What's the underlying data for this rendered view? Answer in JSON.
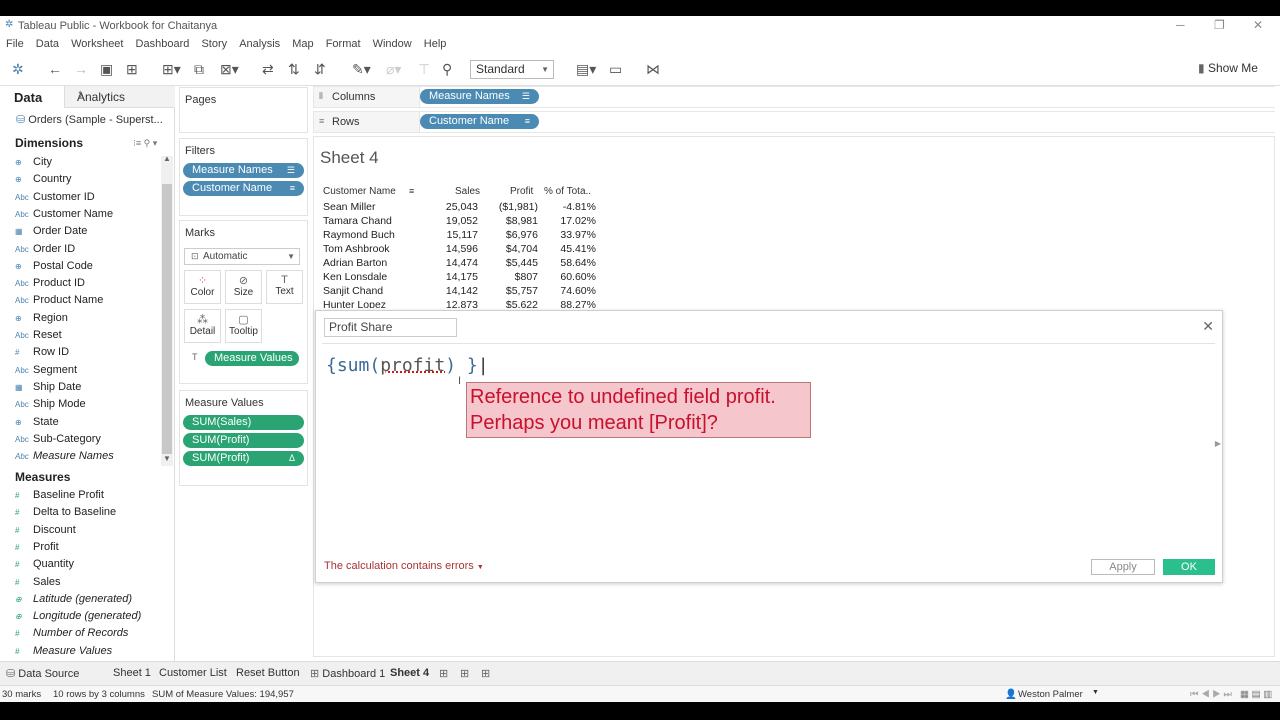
{
  "window": {
    "title": "Tableau Public - Workbook for Chaitanya",
    "controls": [
      "─",
      "❐",
      "✕"
    ]
  },
  "menu": [
    "File",
    "Data",
    "Worksheet",
    "Dashboard",
    "Story",
    "Analysis",
    "Map",
    "Format",
    "Window",
    "Help"
  ],
  "toolbar": {
    "fit": "Standard",
    "show_me": "Show Me"
  },
  "left_pane": {
    "tab_data": "Data",
    "tab_analytics": "Analytics",
    "datasource": "Orders (Sample - Superst...",
    "dimensions_label": "Dimensions",
    "dimensions": [
      {
        "icon": "⊕",
        "label": "City"
      },
      {
        "icon": "⊕",
        "label": "Country"
      },
      {
        "icon": "Abc",
        "label": "Customer ID"
      },
      {
        "icon": "Abc",
        "label": "Customer Name"
      },
      {
        "icon": "▦",
        "label": "Order Date"
      },
      {
        "icon": "Abc",
        "label": "Order ID"
      },
      {
        "icon": "⊕",
        "label": "Postal Code"
      },
      {
        "icon": "Abc",
        "label": "Product ID"
      },
      {
        "icon": "Abc",
        "label": "Product Name"
      },
      {
        "icon": "⊕",
        "label": "Region"
      },
      {
        "icon": "Abc",
        "label": "Reset"
      },
      {
        "icon": "#",
        "label": "Row ID"
      },
      {
        "icon": "Abc",
        "label": "Segment"
      },
      {
        "icon": "▦",
        "label": "Ship Date"
      },
      {
        "icon": "Abc",
        "label": "Ship Mode"
      },
      {
        "icon": "⊕",
        "label": "State"
      },
      {
        "icon": "Abc",
        "label": "Sub-Category"
      },
      {
        "icon": "Abc",
        "label": "Measure Names"
      }
    ],
    "measures_label": "Measures",
    "measures": [
      {
        "icon": "#",
        "label": "Baseline Profit"
      },
      {
        "icon": "#",
        "label": "Delta to Baseline"
      },
      {
        "icon": "#",
        "label": "Discount"
      },
      {
        "icon": "#",
        "label": "Profit"
      },
      {
        "icon": "#",
        "label": "Quantity"
      },
      {
        "icon": "#",
        "label": "Sales"
      },
      {
        "icon": "⊕",
        "label": "Latitude (generated)"
      },
      {
        "icon": "⊕",
        "label": "Longitude (generated)"
      },
      {
        "icon": "#",
        "label": "Number of Records"
      },
      {
        "icon": "#",
        "label": "Measure Values"
      }
    ]
  },
  "shelves": {
    "pages": "Pages",
    "filters": "Filters",
    "filter_pills": [
      "Measure Names",
      "Customer Name"
    ],
    "marks": "Marks",
    "mark_type": "Automatic",
    "mark_buttons": [
      "Color",
      "Size",
      "Text",
      "Detail",
      "Tooltip"
    ],
    "marks_pill": "Measure Values",
    "measure_values_card": "Measure Values",
    "mv_pills": [
      "SUM(Sales)",
      "SUM(Profit)",
      "SUM(Profit)"
    ],
    "columns": "Columns",
    "rows": "Rows",
    "columns_pill": "Measure Names",
    "rows_pill": "Customer Name"
  },
  "view": {
    "sheet_title": "Sheet 4",
    "headers": [
      "Customer Name",
      "Sales",
      "Profit",
      "% of Tota.."
    ],
    "rows": [
      {
        "name": "Sean Miller",
        "sales": "25,043",
        "profit": "($1,981)",
        "pct": "-4.81%"
      },
      {
        "name": "Tamara Chand",
        "sales": "19,052",
        "profit": "$8,981",
        "pct": "17.02%"
      },
      {
        "name": "Raymond Buch",
        "sales": "15,117",
        "profit": "$6,976",
        "pct": "33.97%"
      },
      {
        "name": "Tom Ashbrook",
        "sales": "14,596",
        "profit": "$4,704",
        "pct": "45.41%"
      },
      {
        "name": "Adrian Barton",
        "sales": "14,474",
        "profit": "$5,445",
        "pct": "58.64%"
      },
      {
        "name": "Ken Lonsdale",
        "sales": "14,175",
        "profit": "$807",
        "pct": "60.60%"
      },
      {
        "name": "Sanjit Chand",
        "sales": "14,142",
        "profit": "$5,757",
        "pct": "74.60%"
      },
      {
        "name": "Hunter Lopez",
        "sales": "12,873",
        "profit": "$5,622",
        "pct": "88.27%"
      }
    ]
  },
  "dialog": {
    "calc_name": "Profit Share",
    "formula_open": "{sum(",
    "formula_err": "profit",
    "formula_close": ") }",
    "error_tip_line1": "Reference to undefined field profit.",
    "error_tip_line2": "Perhaps you meant [Profit]?",
    "status": "The calculation contains errors",
    "apply": "Apply",
    "ok": "OK"
  },
  "sheet_tabs": [
    "Data Source",
    "Sheet 1",
    "Customer List",
    "Reset Button",
    "Dashboard 1",
    "Sheet 4"
  ],
  "status": {
    "marks": "30 marks",
    "dims": "10 rows by 3 columns",
    "sum": "SUM of Measure Values: 194,957",
    "user": "Weston Palmer"
  }
}
